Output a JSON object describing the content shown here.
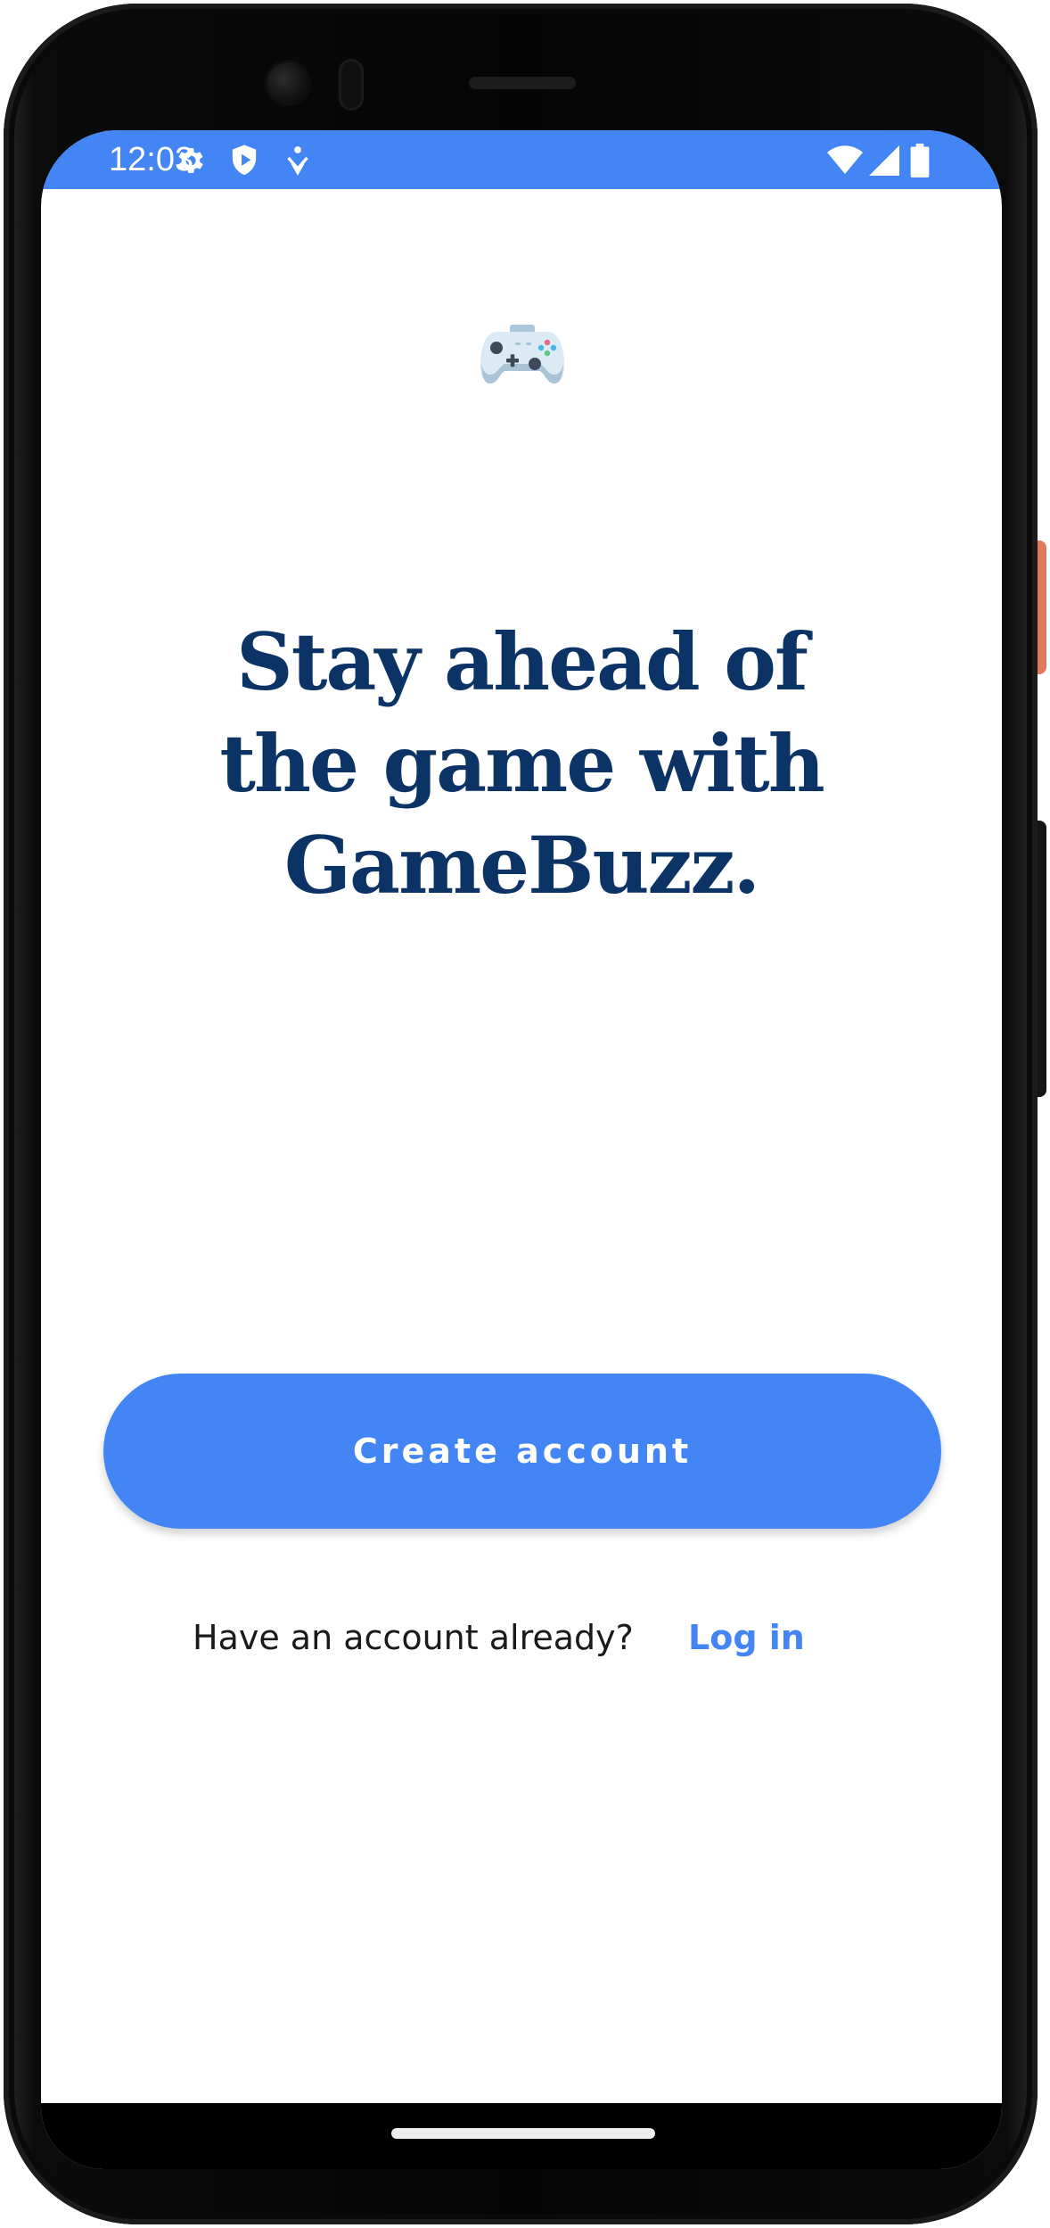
{
  "status_bar": {
    "time": "12:03",
    "color": "#4385f4",
    "left_icons": [
      "gear-icon",
      "shield-play-icon",
      "accessibility-icon"
    ],
    "right_icons": [
      "wifi-icon",
      "signal-icon",
      "battery-icon"
    ]
  },
  "app": {
    "icon": "game-controller-icon",
    "headline": "Stay ahead of\nthe game with\nGameBuzz.",
    "headline_color": "#0b3366",
    "accent_color": "#4385f4"
  },
  "actions": {
    "create_account_label": "Create account",
    "login_prompt": "Have an account already?",
    "login_link": "Log in"
  },
  "navigation": {
    "home_handle": "home-gesture-bar"
  }
}
